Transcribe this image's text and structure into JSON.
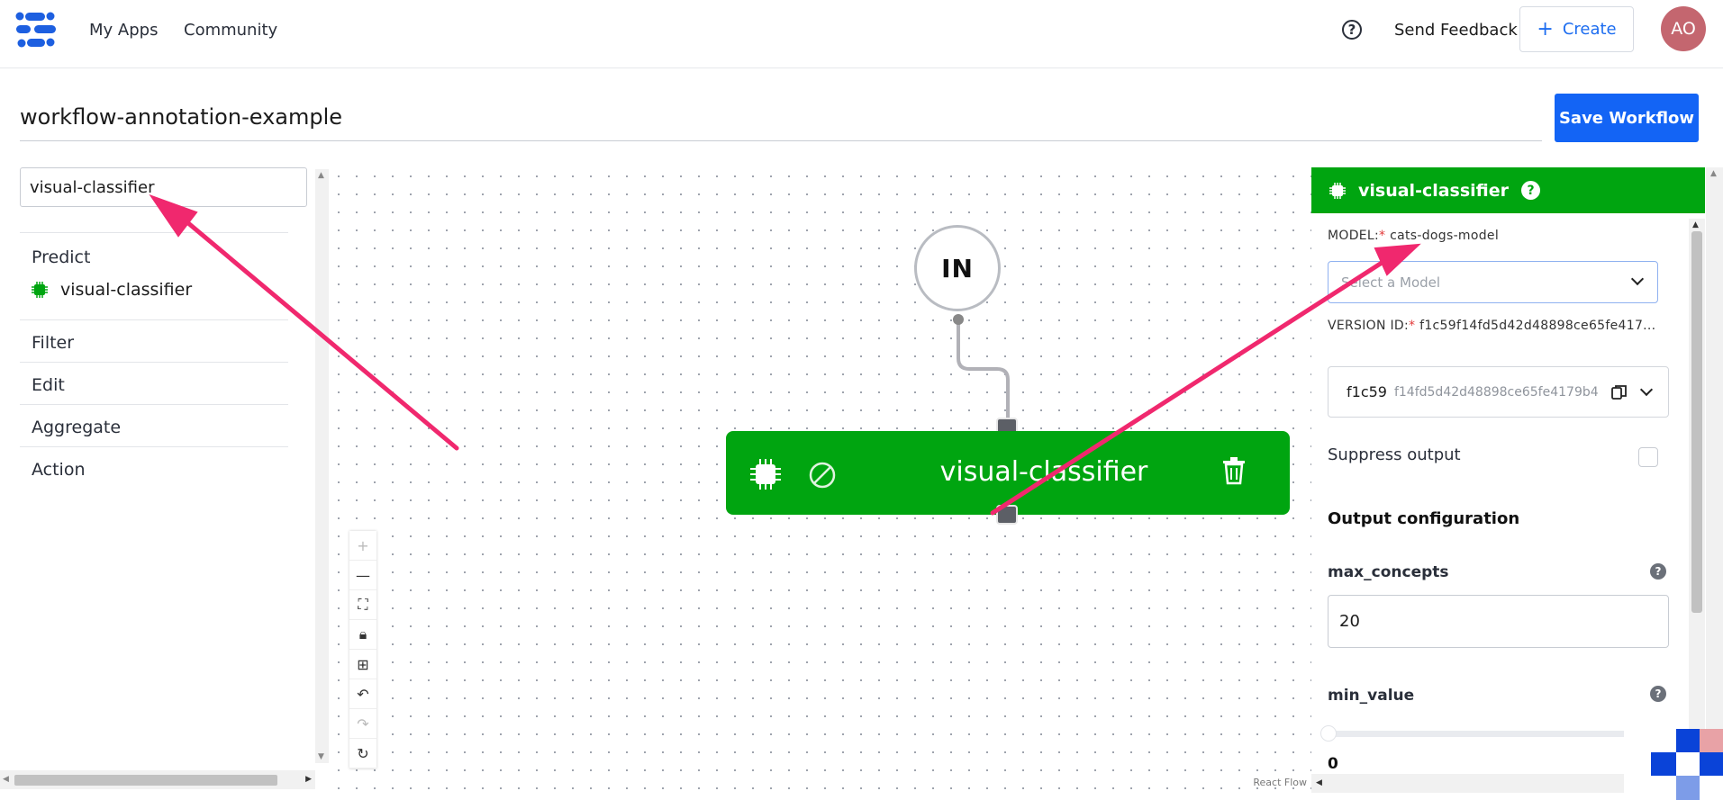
{
  "nav": {
    "my_apps": "My Apps",
    "community": "Community",
    "help": "?",
    "send_feedback": "Send Feedback",
    "create_plus": "+",
    "create": "Create",
    "avatar_initials": "AO"
  },
  "workflow": {
    "title": "workflow-annotation-example",
    "save_label": "Save Workflow"
  },
  "left_panel": {
    "search_value": "visual-classifier",
    "categories": {
      "predict": "Predict",
      "predict_item": "visual-classifier",
      "filter": "Filter",
      "edit": "Edit",
      "aggregate": "Aggregate",
      "action": "Action"
    }
  },
  "canvas": {
    "in_node": "IN",
    "node_label": "visual-classifier",
    "react_flow": "React Flow",
    "colors": {
      "node": "#00a510",
      "edge": "#b1b1b7"
    }
  },
  "right_panel": {
    "header_title": "visual-classifier",
    "header_help": "?",
    "model_label": "MODEL:",
    "required_mark": "*",
    "model_value": "cats-dogs-model",
    "select_placeholder": "Select a Model",
    "version_label": "VERSION ID:",
    "version_value": "f1c59f14fd5d42d48898ce65fe417...",
    "version_short": "f1c59",
    "version_full": "f14fd5d42d48898ce65fe4179b4",
    "suppress_label": "Suppress output",
    "output_heading": "Output configuration",
    "max_concepts_label": "max_concepts",
    "max_concepts_value": "20",
    "min_value_label": "min_value",
    "min_value_value": "0",
    "help": "?"
  },
  "colors": {
    "accent": "#1364f5",
    "green": "#00a510",
    "annotation_arrow": "#f0286e",
    "avatar": "#c4666f"
  }
}
